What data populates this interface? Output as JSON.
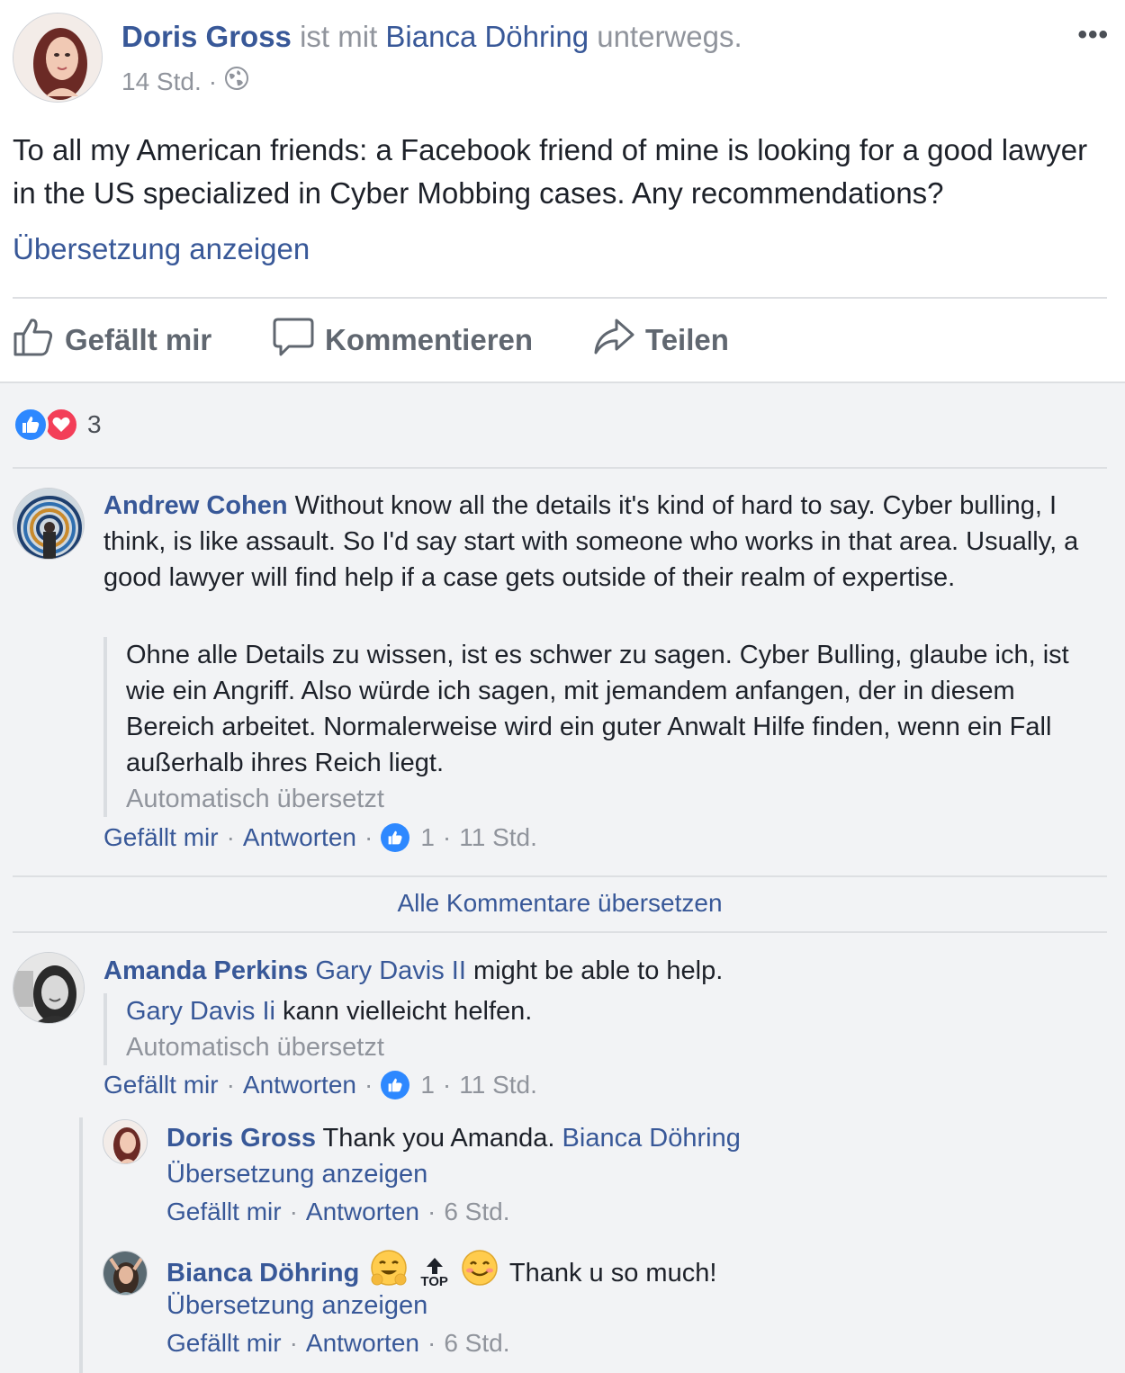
{
  "post": {
    "author": "Doris Gross",
    "with_text": " ist mit ",
    "tagged": "Bianca Döhring",
    "suffix": " unterwegs.",
    "time": "14 Std.",
    "dot": "·",
    "privacy_icon": "globe-icon",
    "more_label": "•••",
    "text": "To all my American friends: a Facebook friend of mine is looking for a good lawyer in the US specialized in Cyber Mobbing cases. Any recommendations?",
    "see_translation": "Übersetzung anzeigen"
  },
  "actions": {
    "like": "Gefällt mir",
    "comment": "Kommentieren",
    "share": "Teilen"
  },
  "reactions": {
    "count": "3",
    "icons": [
      "like-reaction-icon",
      "love-reaction-icon"
    ]
  },
  "comments": [
    {
      "author": "Andrew Cohen",
      "text": " Without know all the details it's kind of hard to say. Cyber bulling, I think, is like assault. So I'd say start with someone who works in that area. Usually, a good lawyer will find help if a case gets outside of their realm of expertise.",
      "translation": "Ohne alle Details zu wissen, ist es schwer zu sagen. Cyber Bulling, glaube ich, ist wie ein Angriff. Also würde ich sagen, mit jemandem anfangen, der in diesem Bereich arbeitet. Normalerweise wird ein guter Anwalt Hilfe finden, wenn ein Fall außerhalb ihres Reich liegt.",
      "auto_translated": "Automatisch übersetzt",
      "like": "Gefällt mir",
      "reply": "Antworten",
      "likes": "1",
      "time": "11 Std."
    },
    {
      "author": "Amanda Perkins",
      "mention": "Gary Davis II",
      "text": " might be able to help.",
      "translation_mention": "Gary Davis Ii",
      "translation_text": " kann vielleicht helfen.",
      "auto_translated": "Automatisch übersetzt",
      "like": "Gefällt mir",
      "reply": "Antworten",
      "likes": "1",
      "time": "11 Std."
    }
  ],
  "translate_all": "Alle Kommentare übersetzen",
  "replies": [
    {
      "author": "Doris Gross",
      "text": " Thank you Amanda. ",
      "mention": "Bianca Döhring",
      "see_translation": "Übersetzung anzeigen",
      "like": "Gefällt mir",
      "reply": "Antworten",
      "time": "6 Std."
    },
    {
      "author": "Bianca Döhring",
      "emojis": [
        "hugging-face-emoji",
        "top-arrow-emoji",
        "smiling-face-emoji"
      ],
      "top_label": "TOP",
      "text": "Thank u so much!",
      "see_translation": "Übersetzung anzeigen",
      "like": "Gefällt mir",
      "reply": "Antworten",
      "time": "6 Std."
    }
  ],
  "colors": {
    "link": "#385898",
    "muted": "#90949c",
    "like_blue": "#2d88ff",
    "love_red": "#f33e58",
    "comment_bg": "#f2f3f5"
  }
}
